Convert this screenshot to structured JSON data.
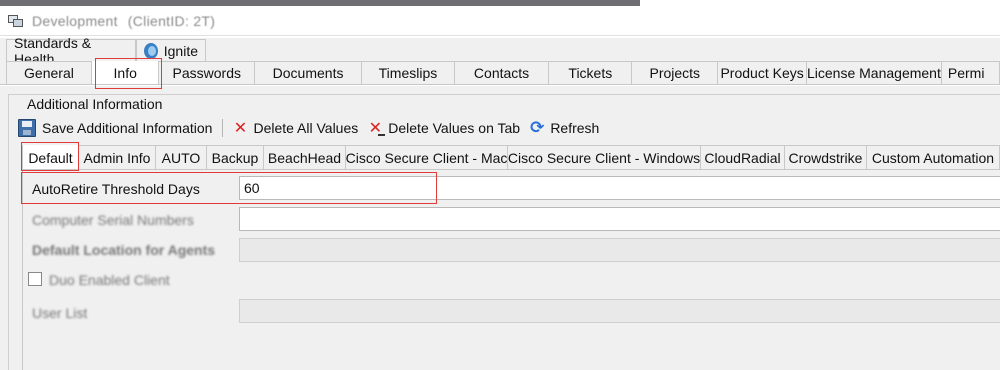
{
  "window": {
    "title": "Development",
    "client": "(ClientID: 2T)"
  },
  "top_tabs": [
    "Standards & Health",
    "Ignite"
  ],
  "main_tabs": [
    "General",
    "Info",
    "Passwords",
    "Documents",
    "Timeslips",
    "Contacts",
    "Tickets",
    "Projects",
    "Product Keys",
    "License Management",
    "Permi"
  ],
  "active_main_tab": "Info",
  "group_label": "Additional Information",
  "toolbar": {
    "save": "Save Additional Information",
    "delete_all": "Delete All Values",
    "delete_tab": "Delete Values on Tab",
    "refresh": "Refresh"
  },
  "sub_tabs": [
    "Default",
    "Admin Info",
    "AUTO",
    "Backup",
    "BeachHead",
    "Cisco Secure Client - Mac",
    "Cisco Secure Client - Windows",
    "CloudRadial",
    "Crowdstrike",
    "Custom Automation"
  ],
  "active_sub_tab": "Default",
  "fields": {
    "autoretire_label": "AutoRetire Threshold Days",
    "autoretire_value": "60",
    "serial_label": "Computer Serial Numbers",
    "location_label": "Default Location for Agents",
    "duo_label": "Duo Enabled Client",
    "userlist_label": "User List"
  },
  "colors": {
    "highlight": "#e03a3a",
    "refresh": "#2a6fd6",
    "delete": "#d22222"
  }
}
